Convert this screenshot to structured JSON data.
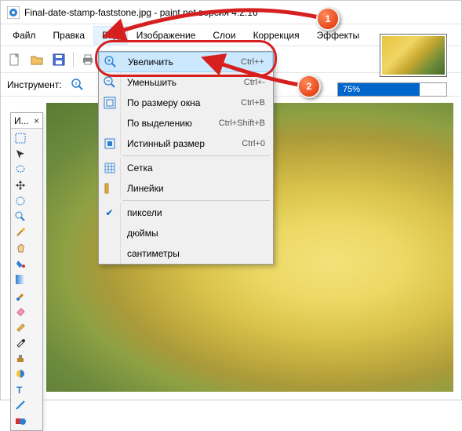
{
  "titlebar": {
    "text": "Final-date-stamp-faststone.jpg - paint.net версия 4.2.16"
  },
  "menubar": {
    "items": [
      "Файл",
      "Правка",
      "Вид",
      "Изображение",
      "Слои",
      "Коррекция",
      "Эффекты"
    ]
  },
  "toolbar": {
    "instrument_label": "Инструмент:"
  },
  "dropdown": {
    "rows": [
      {
        "icon": "zoom-in",
        "label": "Увеличить",
        "shortcut": "Ctrl++",
        "hl": true
      },
      {
        "icon": "zoom-out",
        "label": "Уменьшить",
        "shortcut": "Ctrl+-"
      },
      {
        "icon": "fit",
        "label": "По размеру окна",
        "shortcut": "Ctrl+B"
      },
      {
        "icon": "",
        "label": "По выделению",
        "shortcut": "Ctrl+Shift+B"
      },
      {
        "icon": "actual",
        "label": "Истинный размер",
        "shortcut": "Ctrl+0"
      },
      {
        "sep": true
      },
      {
        "icon": "grid",
        "label": "Сетка",
        "shortcut": ""
      },
      {
        "icon": "rulers",
        "label": "Линейки",
        "shortcut": ""
      },
      {
        "sep": true
      },
      {
        "icon": "check",
        "label": "пиксели",
        "shortcut": ""
      },
      {
        "icon": "",
        "label": "дюймы",
        "shortcut": ""
      },
      {
        "icon": "",
        "label": "сантиметры",
        "shortcut": ""
      }
    ]
  },
  "toolbox": {
    "title": "И..."
  },
  "progress": {
    "text": "75%"
  },
  "callouts": {
    "c1": "1",
    "c2": "2"
  }
}
